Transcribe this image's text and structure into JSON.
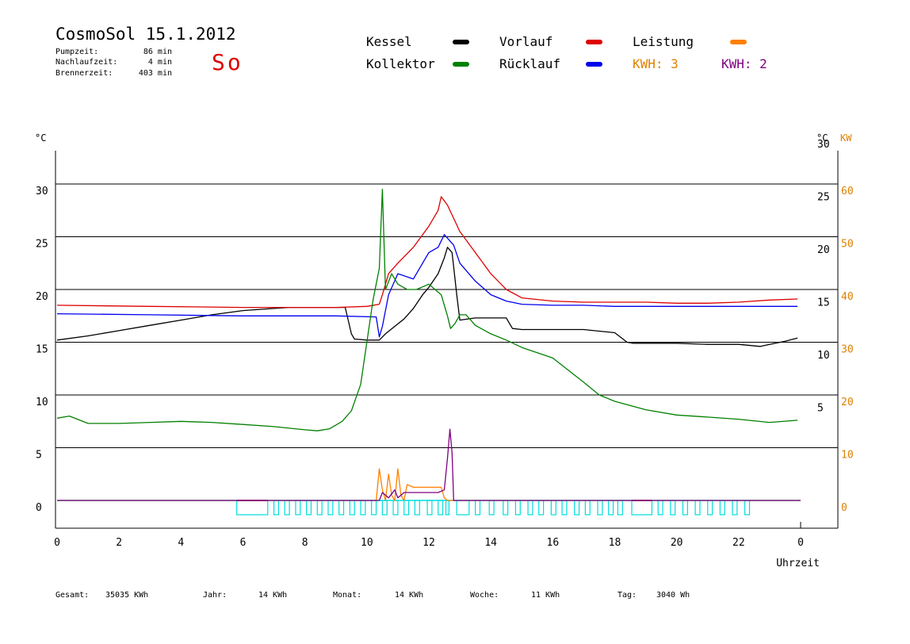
{
  "header": {
    "title": "CosmoSol 15.1.2012",
    "day": "So",
    "stats": [
      {
        "label": "Pumpzeit:",
        "value": "86 min"
      },
      {
        "label": "Nachlaufzeit:",
        "value": "4 min"
      },
      {
        "label": "Brennerzeit:",
        "value": "403 min"
      }
    ]
  },
  "legend": {
    "items": [
      {
        "label": "Kessel",
        "color": "#000000"
      },
      {
        "label": "Vorlauf",
        "color": "#dd0000"
      },
      {
        "label": "Leistung",
        "color": "#ff8000"
      },
      {
        "label": "Kollektor",
        "color": "#008000"
      },
      {
        "label": "Rücklauf",
        "color": "#0000ee"
      }
    ],
    "kwh": [
      {
        "label": "KWH: 3",
        "color": "#e08000"
      },
      {
        "label": "KWH: 2",
        "color": "#800080"
      }
    ]
  },
  "axes": {
    "left_unit": "°C",
    "right_unit_c": "°C",
    "right_unit_kw": "KW",
    "left_ticks": [
      "0",
      "5",
      "10",
      "15",
      "20",
      "25",
      "30"
    ],
    "right_ticks_c": [
      "5",
      "10",
      "15",
      "20",
      "25",
      "30"
    ],
    "right_ticks_kw": [
      "0",
      "10",
      "20",
      "30",
      "40",
      "50",
      "60"
    ],
    "x_ticks": [
      "0",
      "2",
      "4",
      "6",
      "8",
      "10",
      "12",
      "14",
      "16",
      "18",
      "20",
      "22",
      "0"
    ],
    "xlabel": "Uhrzeit"
  },
  "footer": [
    {
      "label": "Gesamt:",
      "value": "35035 KWh"
    },
    {
      "label": "Jahr:",
      "value": "14 KWh"
    },
    {
      "label": "Monat:",
      "value": "14 KWh"
    },
    {
      "label": "Woche:",
      "value": "11 KWh"
    },
    {
      "label": "Tag:",
      "value": "3040 Wh"
    }
  ],
  "colors": {
    "kessel": "#000000",
    "vorlauf": "#dd0000",
    "ruecklauf": "#0000ee",
    "kollektor": "#008000",
    "leistung": "#ff8000",
    "kwh2": "#800080",
    "pump": "#00dddd",
    "grid": "#000000",
    "kw_axis": "#e08000"
  },
  "chart_data": {
    "type": "line",
    "xlabel": "Uhrzeit",
    "xlim": [
      0,
      24
    ],
    "ylim": [
      0,
      30
    ],
    "y2lim": [
      0,
      60
    ],
    "grid": true,
    "series": [
      {
        "name": "Kessel",
        "key": "kessel",
        "x": [
          0,
          1,
          2,
          3,
          4,
          5,
          6,
          7,
          7.5,
          8,
          9,
          9.3,
          9.5,
          9.6,
          10,
          10.4,
          10.6,
          10.9,
          11.2,
          11.5,
          11.8,
          12,
          12.3,
          12.5,
          12.6,
          12.75,
          12.9,
          13,
          13.5,
          14,
          14.5,
          14.7,
          15,
          16,
          17,
          18,
          18.4,
          18.6,
          19,
          20,
          21,
          22,
          22.7,
          23,
          23.5,
          23.9
        ],
        "y": [
          15.2,
          15.6,
          16.1,
          16.6,
          17.1,
          17.6,
          18,
          18.2,
          18.3,
          18.3,
          18.3,
          18.3,
          15.8,
          15.3,
          15.2,
          15.2,
          15.8,
          16.5,
          17.2,
          18.2,
          19.5,
          20.2,
          21.5,
          23,
          24,
          23.5,
          19.5,
          17.1,
          17.3,
          17.3,
          17.3,
          16.3,
          16.2,
          16.2,
          16.2,
          15.9,
          15,
          14.9,
          14.9,
          14.9,
          14.8,
          14.8,
          14.6,
          14.8,
          15.1,
          15.4
        ]
      },
      {
        "name": "Vorlauf",
        "key": "vorlauf",
        "x": [
          0,
          3,
          6,
          9,
          10,
          10.4,
          10.5,
          10.7,
          11,
          11.5,
          12,
          12.3,
          12.4,
          12.6,
          13,
          13.5,
          14,
          14.5,
          15,
          16,
          17,
          18,
          19,
          20,
          21,
          22,
          23,
          23.9
        ],
        "y": [
          18.5,
          18.4,
          18.3,
          18.3,
          18.4,
          18.6,
          19.5,
          21.5,
          22.5,
          24,
          26,
          27.5,
          28.8,
          28,
          25.5,
          23.5,
          21.5,
          20,
          19.2,
          18.9,
          18.8,
          18.8,
          18.8,
          18.7,
          18.7,
          18.8,
          19,
          19.1
        ]
      },
      {
        "name": "Rücklauf",
        "key": "ruecklauf",
        "x": [
          0,
          3,
          6,
          9,
          10.3,
          10.4,
          10.5,
          10.7,
          11,
          11.5,
          12,
          12.3,
          12.5,
          12.8,
          13,
          13.5,
          14,
          14.5,
          15,
          16,
          17,
          18,
          19,
          20,
          22,
          23.9
        ],
        "y": [
          17.7,
          17.6,
          17.5,
          17.5,
          17.4,
          15.5,
          16.5,
          19.5,
          21.5,
          21,
          23.5,
          24,
          25.2,
          24.2,
          22.5,
          20.8,
          19.5,
          18.9,
          18.6,
          18.5,
          18.5,
          18.4,
          18.4,
          18.4,
          18.4,
          18.4
        ]
      },
      {
        "name": "Kollektor",
        "key": "kollektor",
        "x": [
          0,
          0.4,
          1,
          2,
          3,
          4,
          5,
          6,
          7,
          8,
          8.4,
          8.8,
          9.2,
          9.5,
          9.8,
          10,
          10.2,
          10.4,
          10.5,
          10.6,
          10.8,
          11,
          11.3,
          11.6,
          12,
          12.2,
          12.4,
          12.6,
          12.7,
          12.85,
          13,
          13.2,
          13.5,
          14,
          14.5,
          15,
          16,
          17,
          17.5,
          18,
          19,
          20,
          21,
          22,
          23,
          23.9
        ],
        "y": [
          7.8,
          8,
          7.3,
          7.3,
          7.4,
          7.5,
          7.4,
          7.2,
          7,
          6.7,
          6.6,
          6.8,
          7.5,
          8.5,
          11,
          15,
          19,
          22,
          29.5,
          20,
          21.5,
          20.5,
          20,
          20,
          20.5,
          20,
          19.5,
          17.5,
          16.3,
          16.8,
          17.6,
          17.6,
          16.6,
          15.8,
          15.2,
          14.5,
          13.5,
          11.2,
          10,
          9.4,
          8.6,
          8.1,
          7.9,
          7.7,
          7.4,
          7.6
        ]
      },
      {
        "name": "Leistung",
        "key": "leistung",
        "axis": "right",
        "x": [
          0,
          10.3,
          10.4,
          10.5,
          10.6,
          10.7,
          10.8,
          10.9,
          11,
          11.1,
          11.2,
          11.3,
          11.5,
          12,
          12.4,
          12.5,
          12.6,
          24
        ],
        "y": [
          0,
          0,
          6,
          2,
          0,
          5,
          1,
          0,
          6,
          1,
          0,
          3,
          2.5,
          2.5,
          2.5,
          0.5,
          0,
          0
        ]
      },
      {
        "name": "KWH: 2",
        "key": "kwh2",
        "axis": "right",
        "x": [
          0,
          10.4,
          10.5,
          10.7,
          10.9,
          11,
          11.2,
          11.4,
          12,
          12.3,
          12.5,
          12.6,
          12.68,
          12.75,
          12.8,
          24
        ],
        "y": [
          0,
          0,
          1.5,
          0.5,
          2,
          0.5,
          1.5,
          1.5,
          1.5,
          1.5,
          2,
          8,
          13.5,
          9,
          0,
          0
        ]
      }
    ],
    "pump_intervals": [
      [
        5.8,
        6.8
      ],
      [
        7.0,
        7.15
      ],
      [
        7.35,
        7.5
      ],
      [
        7.7,
        7.85
      ],
      [
        8.05,
        8.2
      ],
      [
        8.4,
        8.55
      ],
      [
        8.75,
        8.9
      ],
      [
        9.1,
        9.25
      ],
      [
        9.45,
        9.6
      ],
      [
        9.8,
        9.95
      ],
      [
        10.15,
        10.3
      ],
      [
        10.5,
        10.65
      ],
      [
        10.85,
        11.0
      ],
      [
        11.2,
        11.35
      ],
      [
        11.55,
        11.7
      ],
      [
        11.95,
        12.1
      ],
      [
        12.3,
        12.45
      ],
      [
        12.55,
        12.65
      ],
      [
        12.9,
        13.3
      ],
      [
        13.5,
        13.65
      ],
      [
        13.95,
        14.1
      ],
      [
        14.4,
        14.55
      ],
      [
        14.8,
        14.95
      ],
      [
        15.2,
        15.35
      ],
      [
        15.55,
        15.7
      ],
      [
        15.95,
        16.1
      ],
      [
        16.3,
        16.45
      ],
      [
        16.7,
        16.85
      ],
      [
        17.05,
        17.2
      ],
      [
        17.45,
        17.6
      ],
      [
        17.8,
        17.95
      ],
      [
        18.1,
        18.25
      ],
      [
        18.55,
        19.2
      ],
      [
        19.4,
        19.55
      ],
      [
        19.8,
        19.95
      ],
      [
        20.2,
        20.35
      ],
      [
        20.6,
        20.75
      ],
      [
        21.0,
        21.15
      ],
      [
        21.4,
        21.55
      ],
      [
        21.8,
        21.95
      ],
      [
        22.2,
        22.35
      ]
    ],
    "pump_kwh2_intervals": [
      [
        5.8,
        6.8
      ],
      [
        18.55,
        19.2
      ]
    ]
  }
}
